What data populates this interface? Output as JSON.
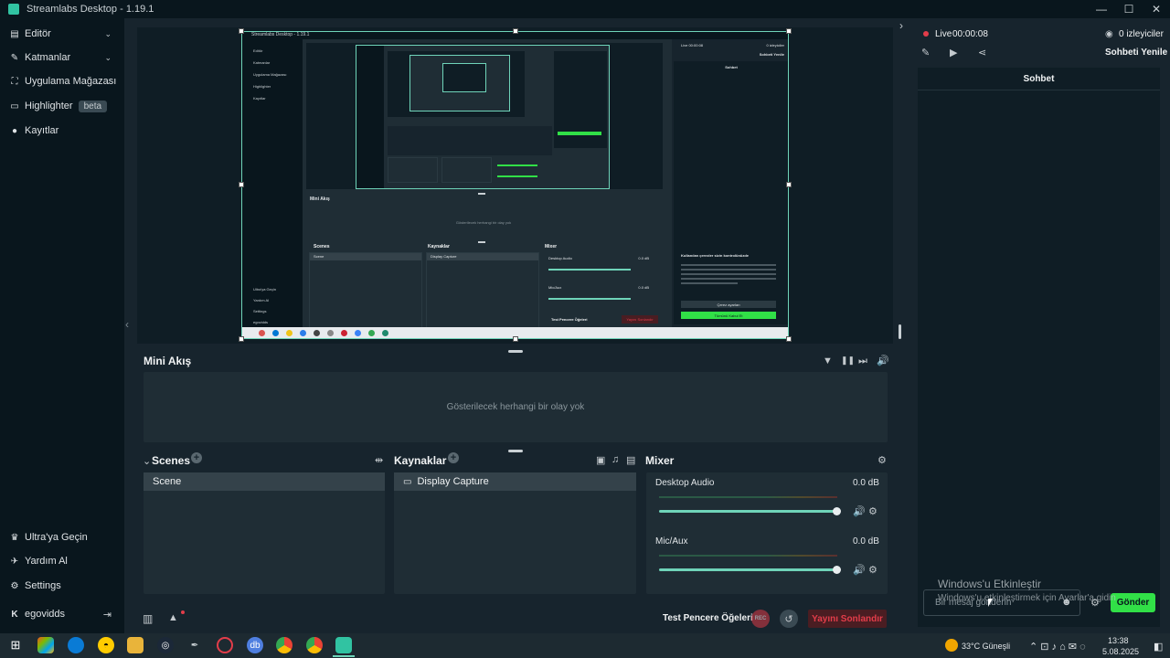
{
  "window": {
    "title": "Streamlabs Desktop - 1.19.1",
    "minimize": "—",
    "maximize": "☐",
    "close": "✕"
  },
  "sidebar": {
    "items": [
      {
        "label": "Editör",
        "icon": "editor-icon",
        "glyph": "▤",
        "chevron": "⌄"
      },
      {
        "label": "Katmanlar",
        "icon": "layers-icon",
        "glyph": "✎",
        "chevron": "⌄"
      },
      {
        "label": "Uygulama Mağazası",
        "icon": "store-icon",
        "glyph": "⛶",
        "chevron": "⌄"
      },
      {
        "label": "Highlighter",
        "icon": "highlighter-icon",
        "glyph": "▭",
        "badge": "beta"
      },
      {
        "label": "Kayıtlar",
        "icon": "recordings-icon",
        "glyph": "●"
      }
    ],
    "bottom": [
      {
        "label": "Ultra'ya Geçin",
        "icon": "ultra-icon",
        "glyph": "♛"
      },
      {
        "label": "Yardım Al",
        "icon": "help-icon",
        "glyph": "✈"
      },
      {
        "label": "Settings",
        "icon": "settings-icon",
        "glyph": "⚙"
      }
    ],
    "user": {
      "name": "egovidds",
      "logo": "K",
      "logout": "⇥"
    },
    "collapse": "‹"
  },
  "mini_feed": {
    "title": "Mini Akış",
    "empty": "Gösterilecek herhangi bir olay yok",
    "filter": "▼",
    "pause": "❚❚",
    "skip": "⏭",
    "volume": "🔊"
  },
  "scenes": {
    "title": "Scenes",
    "collapse": "⌄",
    "add": "+",
    "transition": "⇹",
    "items": [
      "Scene"
    ]
  },
  "sources": {
    "title": "Kaynaklar",
    "add": "+",
    "items": [
      {
        "label": "Display Capture",
        "icon": "monitor-icon"
      }
    ]
  },
  "mixer": {
    "title": "Mixer",
    "settings": "⚙",
    "channels": [
      {
        "name": "Desktop Audio",
        "level": "0.0 dB",
        "volume": 1.0
      },
      {
        "name": "Mic/Aux",
        "level": "0.0 dB",
        "volume": 1.0
      }
    ]
  },
  "bottombar": {
    "test_widgets": "Test Pencere Öğeleri",
    "rec": "REC",
    "end_stream": "Yayını Sonlandır",
    "stats": "▥",
    "alert": "▲",
    "replay": "↺"
  },
  "rightpane": {
    "live_label": "Live",
    "live_time": "00:00:08",
    "viewers": "0 izleyiciler",
    "refresh_chat": "Sohbeti Yenile",
    "chat_title": "Sohbet",
    "toggle": "›",
    "message_placeholder": "Bir mesaj gönderin",
    "send": "Gönder",
    "emoji": "☻",
    "chat_settings": "⚙"
  },
  "activation": {
    "title": "Windows'u Etkinleştir",
    "subtitle": "Windows'u etkinleştirmek için Ayarlar'a gidin"
  },
  "nested_preview": {
    "title": "Streamlabs Desktop - 1.19.1",
    "mini_feed": "Mini Akış",
    "empty": "Gösterilecek herhangi bir olay yok",
    "scenes": "Scenes",
    "sources": "Kaynaklar",
    "mixer": "Mixer",
    "scene": "Scene",
    "display_capture": "Display Capture",
    "desktop_audio": "Desktop Audio",
    "mic": "Mic/Aux",
    "db": "0.0 dB",
    "live": "Live 00:00:08",
    "viewers": "0 izleyiciler",
    "refresh": "Sohbeti Yenile",
    "chat": "Sohbet",
    "consent_title": "Kullanılan çerezler sizin kontrolünüzde",
    "consent_btn": "Çerez ayarları",
    "consent_accept": "Tümünü Kabul Et",
    "test": "Test Pencere Öğeleri",
    "end": "Yayını Sonlandır",
    "side": [
      "Editör",
      "Katmanlar",
      "Uygulama Mağazası",
      "Highlighter",
      "Kayıtlar"
    ],
    "side_bottom": [
      "Ultra'ya Geçin",
      "Yardım Al",
      "Settings",
      "egovidds"
    ]
  },
  "taskbar": {
    "weather": "33°C  Güneşli",
    "time": "13:38",
    "date": "5.08.2025",
    "start": "⊞"
  }
}
